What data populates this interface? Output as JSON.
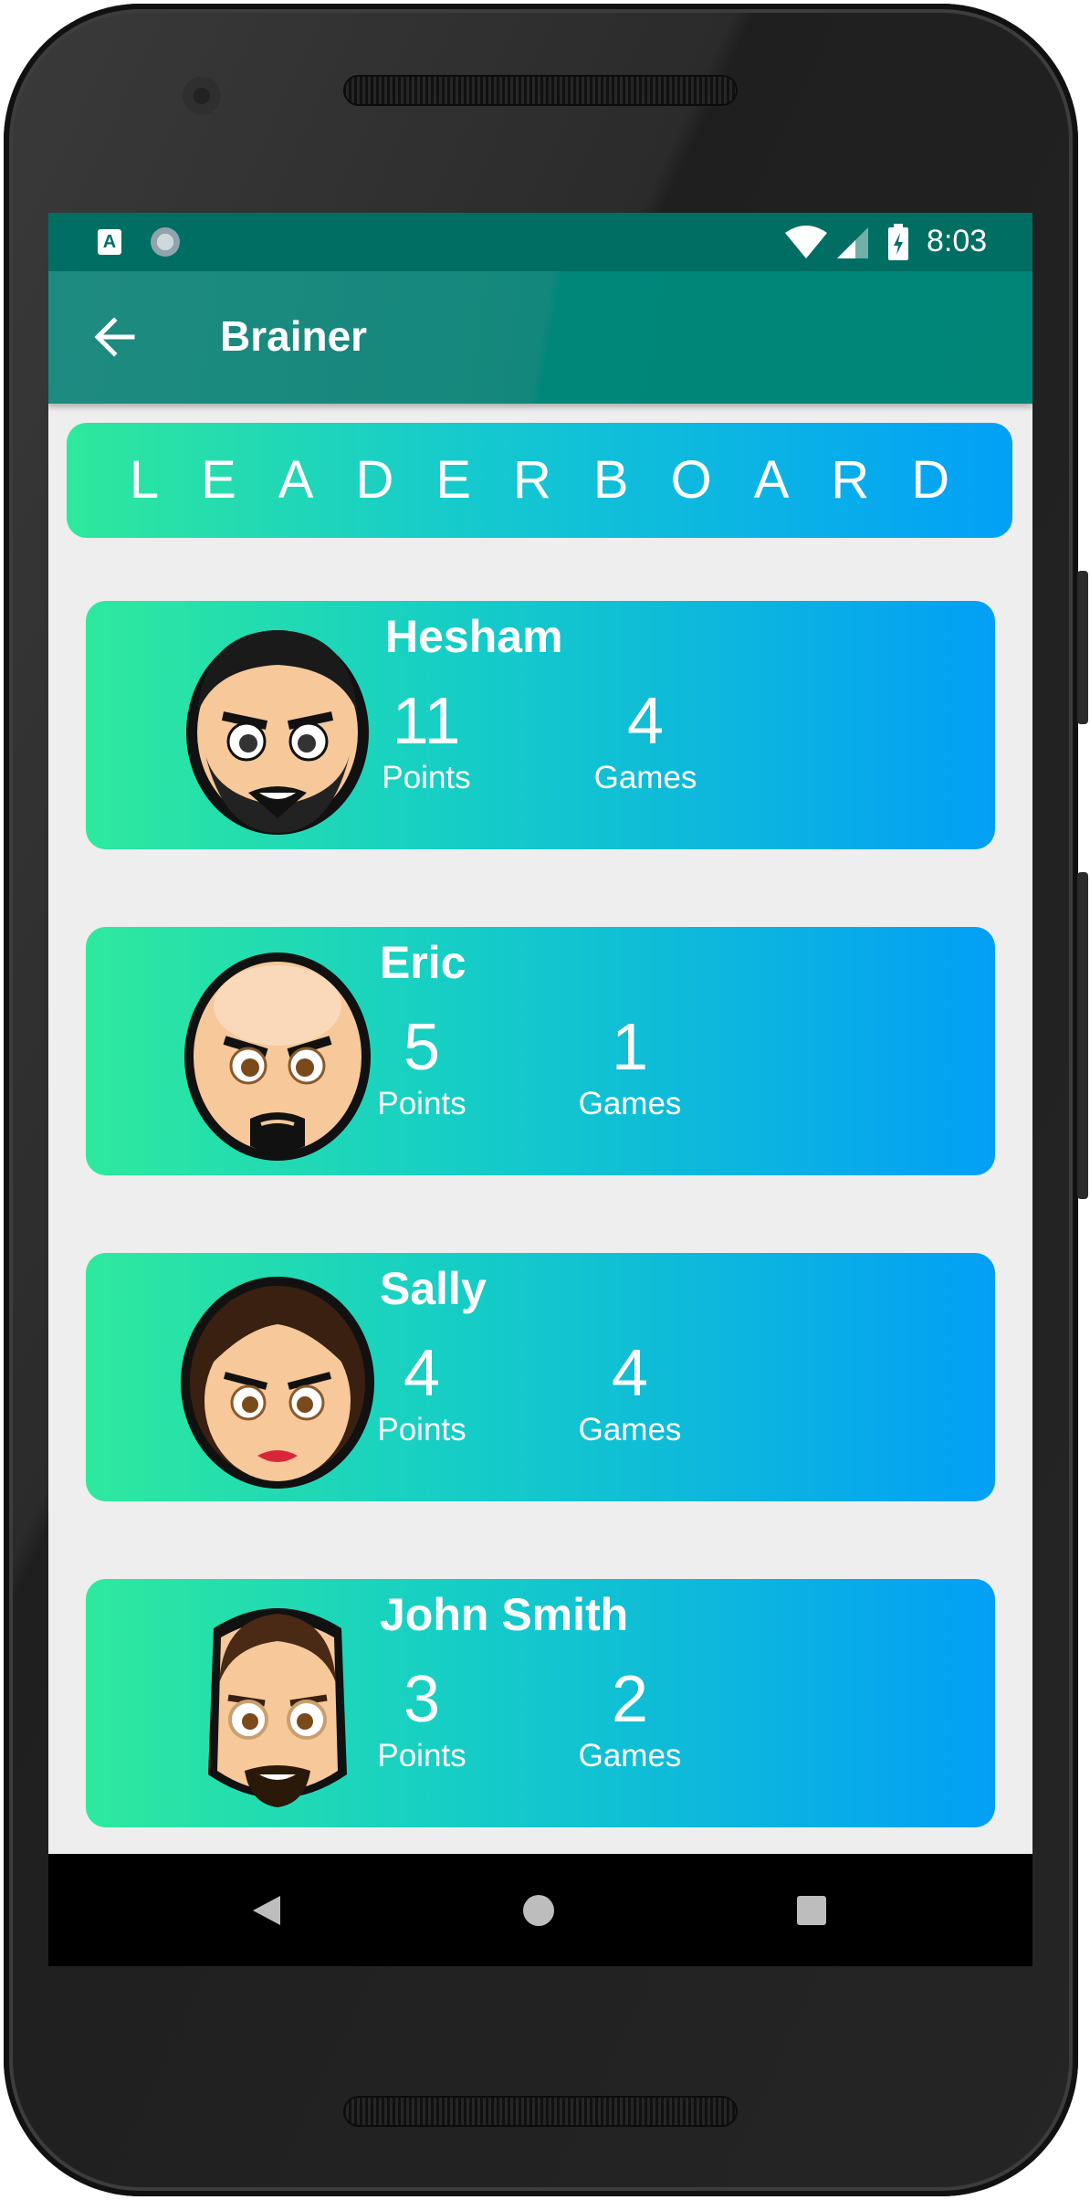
{
  "status_bar": {
    "time": "8:03",
    "notification_a_label": "A"
  },
  "app_bar": {
    "title": "Brainer"
  },
  "banner": {
    "title": "LEADERBOARD"
  },
  "players": [
    {
      "name": "Hesham",
      "points": "11",
      "points_label": "Points",
      "games": "4",
      "games_label": "Games",
      "avatar": "bearded-man-avatar"
    },
    {
      "name": "Eric",
      "points": "5",
      "points_label": "Points",
      "games": "1",
      "games_label": "Games",
      "avatar": "bald-man-avatar"
    },
    {
      "name": "Sally",
      "points": "4",
      "points_label": "Points",
      "games": "4",
      "games_label": "Games",
      "avatar": "woman-avatar"
    },
    {
      "name": "John Smith",
      "points": "3",
      "points_label": "Points",
      "games": "2",
      "games_label": "Games",
      "avatar": "man-glasses-avatar"
    }
  ],
  "colors": {
    "status_bar": "#006e63",
    "app_bar": "#00877a",
    "gradient_start": "#2ee99e",
    "gradient_end": "#039ff6"
  }
}
